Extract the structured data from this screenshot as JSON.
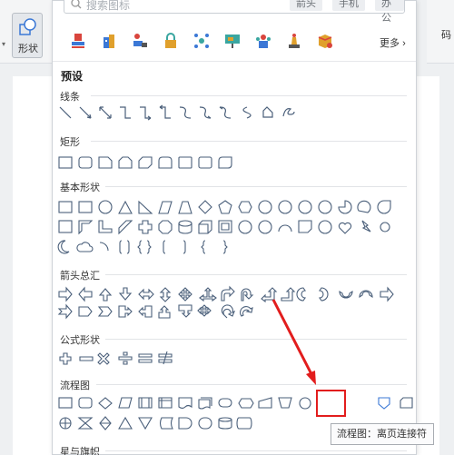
{
  "toolbar": {
    "shape_button_label": "形状",
    "right_label": "码"
  },
  "search": {
    "placeholder": "搜索图标",
    "tags": [
      "箭头",
      "手机",
      "办公"
    ]
  },
  "quick_icons": [
    "stamp-icon",
    "building-icon",
    "laptop-user-icon",
    "lock-icon",
    "network-icon",
    "presentation-icon",
    "team-icon",
    "chess-icon",
    "package-icon"
  ],
  "more_label": "更多",
  "preset_label": "预设",
  "sections": [
    {
      "id": "lines",
      "title": "线条",
      "count": 12
    },
    {
      "id": "rect",
      "title": "矩形",
      "count": 9
    },
    {
      "id": "basic",
      "title": "基本形状",
      "count": 38
    },
    {
      "id": "arrows",
      "title": "箭头总汇",
      "count": 27
    },
    {
      "id": "formula",
      "title": "公式形状",
      "count": 6
    },
    {
      "id": "flowchart",
      "title": "流程图",
      "count": 26
    },
    {
      "id": "stars",
      "title": "星与旗帜",
      "count": 0
    }
  ],
  "tooltip": "流程图：离页连接符",
  "colors": {
    "accent": "#3b78d6",
    "highlight": "#e21d1d"
  }
}
